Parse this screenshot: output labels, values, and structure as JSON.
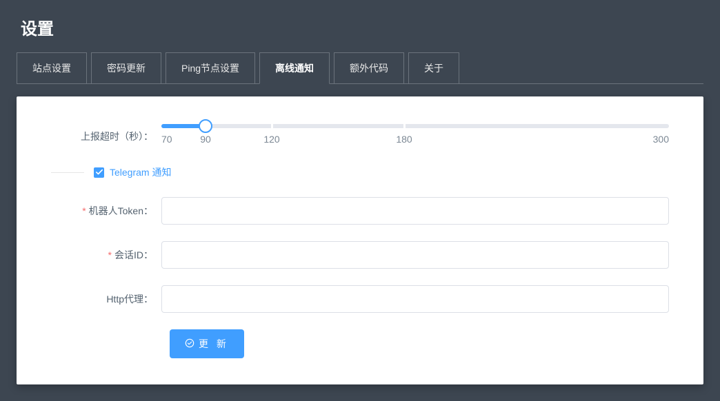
{
  "page": {
    "title": "设置"
  },
  "tabs": [
    {
      "label": "站点设置"
    },
    {
      "label": "密码更新"
    },
    {
      "label": "Ping节点设置"
    },
    {
      "label": "离线通知"
    },
    {
      "label": "额外代码"
    },
    {
      "label": "关于"
    }
  ],
  "active_tab_index": 3,
  "form": {
    "timeout": {
      "label": "上报超时（秒）：",
      "min": 70,
      "max": 300,
      "value": 90,
      "stops": [
        90,
        120,
        180
      ],
      "marks": [
        {
          "v": 70,
          "label": "70"
        },
        {
          "v": 90,
          "label": "90"
        },
        {
          "v": 120,
          "label": "120"
        },
        {
          "v": 180,
          "label": "180"
        },
        {
          "v": 300,
          "label": "300"
        }
      ]
    },
    "telegram": {
      "checkbox_label": "Telegram 通知",
      "checked": true,
      "token_label": "机器人Token：",
      "token_value": "",
      "chat_id_label": "会话ID：",
      "chat_id_value": "",
      "proxy_label": "Http代理：",
      "proxy_value": ""
    },
    "submit_label": "更 新"
  }
}
